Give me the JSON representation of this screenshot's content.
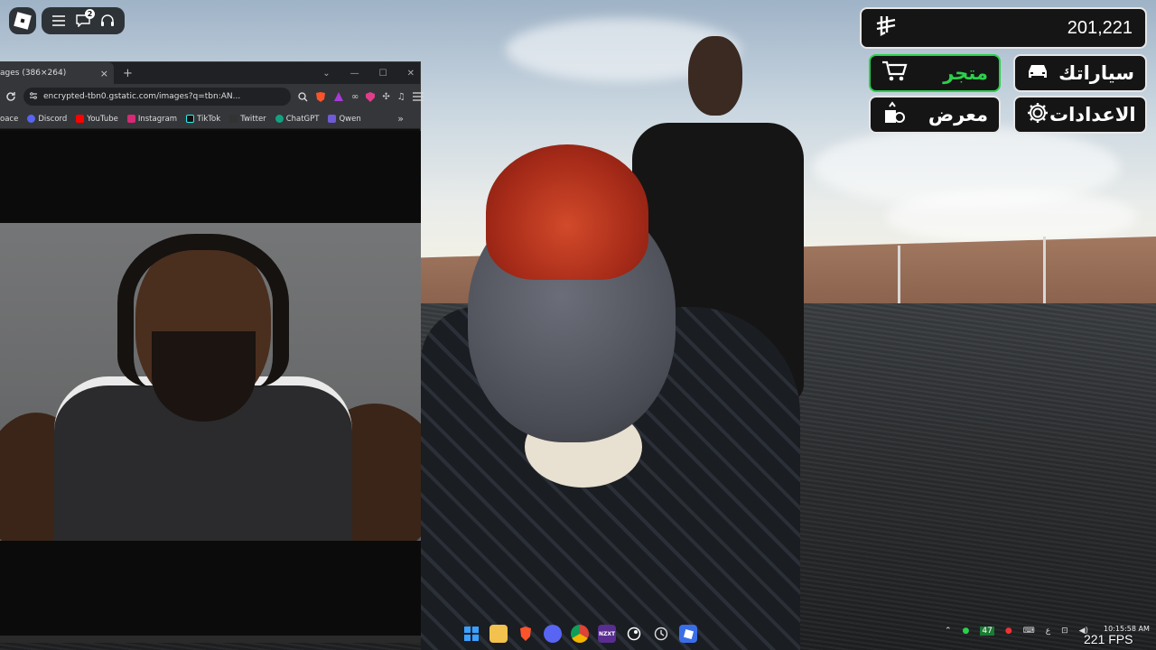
{
  "roblox": {
    "notification_count": "2"
  },
  "hud": {
    "money": "201,221",
    "cars_label": "سياراتك",
    "store_label": "متجر",
    "settings_label": "الاعدادات",
    "showroom_label": "معرض",
    "store_color": "#2bd14a"
  },
  "browser": {
    "tab_title": "ages (386×264)",
    "tab_close": "×",
    "new_tab": "+",
    "url": "encrypted-tbn0.gstatic.com/images?q=tbn:AN...",
    "bookmarks": [
      {
        "label": "oace",
        "color": "#777"
      },
      {
        "label": "Discord",
        "color": "#5865f2"
      },
      {
        "label": "YouTube",
        "color": "#ff0000"
      },
      {
        "label": "Instagram",
        "color": "#d62976"
      },
      {
        "label": "TikTok",
        "color": "#111111"
      },
      {
        "label": "Twitter",
        "color": "#333333"
      },
      {
        "label": "ChatGPT",
        "color": "#10a37f"
      },
      {
        "label": "Qwen",
        "color": "#6f5bd6"
      }
    ],
    "bookmarks_more": "»"
  },
  "taskbar": {
    "apps": [
      "windows-start",
      "file-explorer",
      "brave",
      "discord",
      "chrome",
      "nzxt-cam",
      "steam",
      "clock",
      "roblox"
    ],
    "nzxt_label": "NZXT",
    "tray_temp": "47",
    "tray_lang": "ع",
    "time": "10:15:58 AM"
  },
  "fps": "221 FPS"
}
